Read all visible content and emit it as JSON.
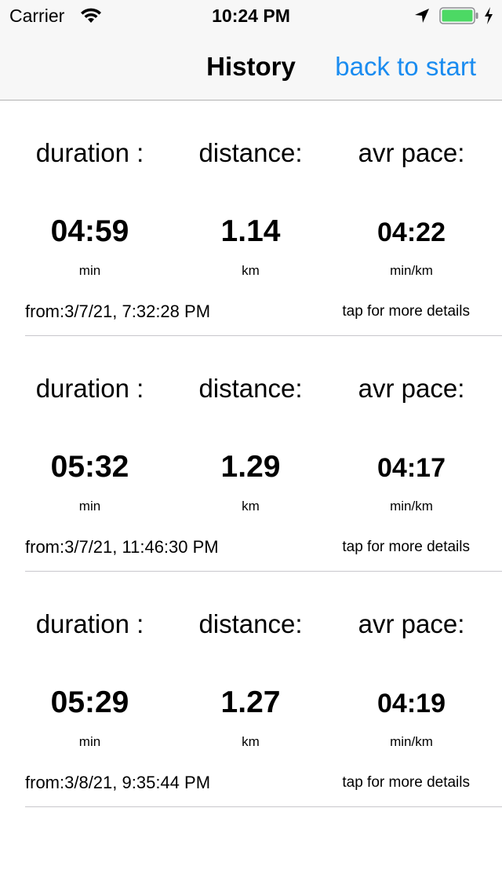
{
  "status_bar": {
    "carrier": "Carrier",
    "time": "10:24 PM",
    "icons": [
      "wifi-icon",
      "location-arrow-icon",
      "battery-icon",
      "charging-bolt-icon"
    ],
    "battery_color": "#4cd964"
  },
  "nav": {
    "title": "History",
    "back_label": "back to start",
    "accent_color": "#1a8cf0"
  },
  "entries": [
    {
      "duration_label": "duration :",
      "distance_label": "distance:",
      "pace_label": "avr pace:",
      "duration": "04:59",
      "duration_unit": "min",
      "distance": "1.14",
      "distance_unit": "km",
      "pace": "04:22",
      "pace_unit": "min/km",
      "from": "from:3/7/21, 7:32:28 PM",
      "details": "tap for more details"
    },
    {
      "duration_label": "duration :",
      "distance_label": "distance:",
      "pace_label": "avr pace:",
      "duration": "05:32",
      "duration_unit": "min",
      "distance": "1.29",
      "distance_unit": "km",
      "pace": "04:17",
      "pace_unit": "min/km",
      "from": "from:3/7/21, 11:46:30 PM",
      "details": "tap for more details"
    },
    {
      "duration_label": "duration :",
      "distance_label": "distance:",
      "pace_label": "avr pace:",
      "duration": "05:29",
      "duration_unit": "min",
      "distance": "1.27",
      "distance_unit": "km",
      "pace": "04:19",
      "pace_unit": "min/km",
      "from": "from:3/8/21, 9:35:44 PM",
      "details": "tap for more details"
    }
  ]
}
